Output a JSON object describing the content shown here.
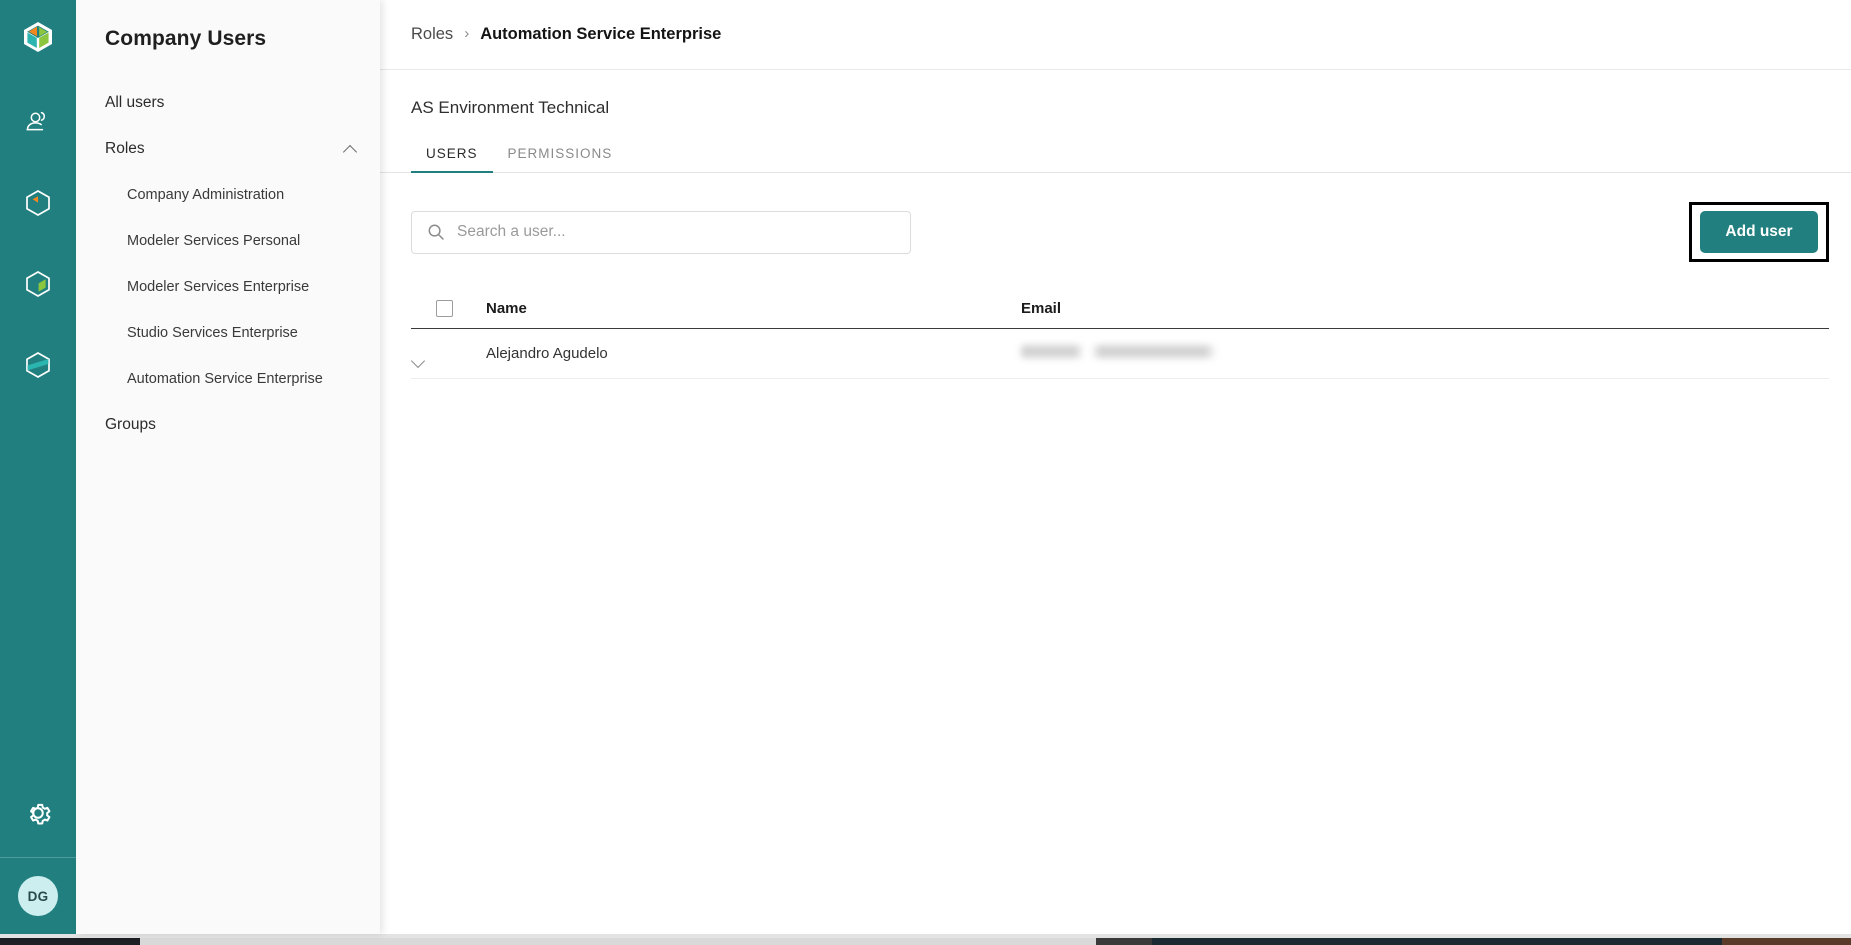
{
  "colors": {
    "brand_teal": "#21807F",
    "panel_bg": "#FAFAFA",
    "avatar_bg": "#CDEEEE",
    "annotation_outline": "#000000"
  },
  "rail": {
    "logo_name": "cube-logo",
    "items": [
      {
        "icon": "users-icon",
        "name": "company-users"
      },
      {
        "icon": "cube-orange-icon",
        "name": "modeler-services"
      },
      {
        "icon": "cube-green-icon",
        "name": "studio-services"
      },
      {
        "icon": "cube-teal-icon",
        "name": "automation-services"
      }
    ],
    "settings_icon": "gear-icon",
    "avatar_initials": "DG"
  },
  "sidebar": {
    "title": "Company Users",
    "items": [
      {
        "label": "All users",
        "type": "link",
        "expanded": null
      },
      {
        "label": "Roles",
        "type": "group",
        "expanded": true
      },
      {
        "label": "Company Administration",
        "type": "sub"
      },
      {
        "label": "Modeler Services Personal",
        "type": "sub"
      },
      {
        "label": "Modeler Services Enterprise",
        "type": "sub"
      },
      {
        "label": "Studio Services Enterprise",
        "type": "sub"
      },
      {
        "label": "Automation Service Enterprise",
        "type": "sub"
      },
      {
        "label": "Groups",
        "type": "link"
      }
    ]
  },
  "breadcrumb": {
    "parent": "Roles",
    "separator": "›",
    "current": "Automation Service Enterprise"
  },
  "page": {
    "role_name": "AS Environment Technical"
  },
  "tabs": [
    {
      "label": "USERS",
      "active": true
    },
    {
      "label": "PERMISSIONS",
      "active": false
    }
  ],
  "toolbar": {
    "search_placeholder": "Search a user...",
    "search_value": "",
    "search_icon": "search-icon",
    "add_user_label": "Add user"
  },
  "table": {
    "columns": [
      "Name",
      "Email"
    ],
    "select_all_checked": false,
    "rows": [
      {
        "expanded": false,
        "name": "Alejandro Agudelo",
        "email": "",
        "email_redacted": true
      }
    ]
  }
}
